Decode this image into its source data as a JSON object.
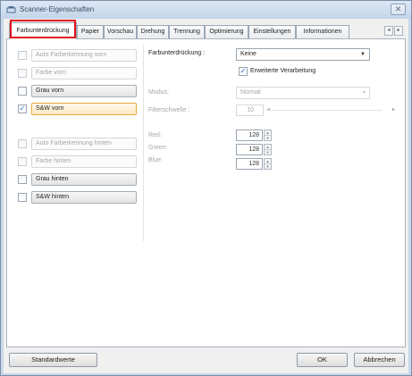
{
  "window": {
    "title": "Scanner-Eigenschaften",
    "close_glyph": "✕"
  },
  "tabs": [
    {
      "label": "Farbunterdrückung",
      "active": true
    },
    {
      "label": "Papier"
    },
    {
      "label": "Vorschau"
    },
    {
      "label": "Drehung"
    },
    {
      "label": "Trennung"
    },
    {
      "label": "Optimierung"
    },
    {
      "label": "Einstellungen"
    },
    {
      "label": "Informationen"
    }
  ],
  "tab_scroll": {
    "left": "◂",
    "right": "▸"
  },
  "image_types": [
    {
      "label": "Auto Farberkennung vorn",
      "checked": false,
      "enabled": false
    },
    {
      "label": "Farbe vorn",
      "checked": false,
      "enabled": false
    },
    {
      "label": "Grau vorn",
      "checked": false,
      "enabled": true
    },
    {
      "label": "S&W vorn",
      "checked": true,
      "enabled": true,
      "selected": true
    },
    {
      "label": "Auto Farberkennung hinten",
      "checked": false,
      "enabled": false
    },
    {
      "label": "Farbe hinten",
      "checked": false,
      "enabled": false
    },
    {
      "label": "Grau hinten",
      "checked": false,
      "enabled": true
    },
    {
      "label": "S&W hinten",
      "checked": false,
      "enabled": true
    }
  ],
  "settings": {
    "farbunterdrueckung_label": "Farbunterdrückung :",
    "farbunterdrueckung_value": "Keine",
    "erweiterte_label": "Erweiterte Verarbeitung",
    "erweiterte_checked": true,
    "modus_label": "Modus:",
    "modus_value": "Normal",
    "filterschwelle_label": "Filterschwelle :",
    "filterschwelle_value": "10",
    "red_label": "Red:",
    "red_value": "128",
    "green_label": "Green:",
    "green_value": "128",
    "blue_label": "Blue:",
    "blue_value": "128"
  },
  "buttons": {
    "defaults": "Standardwerte",
    "ok": "OK",
    "cancel": "Abbrechen"
  },
  "colors": {
    "highlight": "#e0141e",
    "check_accent": "#2b6cc4",
    "selected_border": "#e8a93a"
  }
}
